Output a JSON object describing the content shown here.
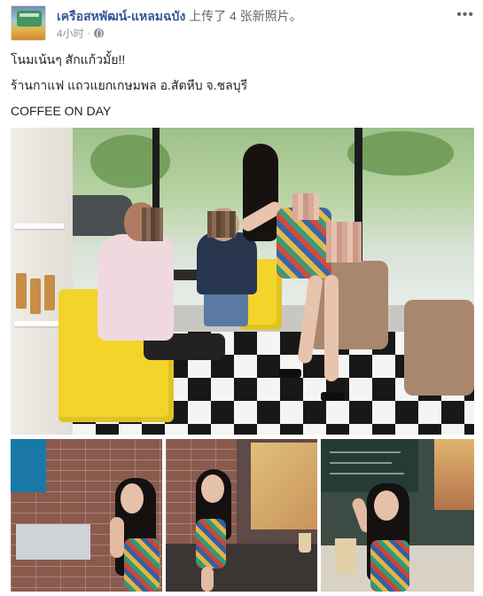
{
  "post": {
    "author_name": "เครือสหพัฒน์-แหลมฉบัง",
    "action_text": "上传了 4 张新照片。",
    "timestamp": "4小时",
    "privacy_icon": "globe-icon",
    "more_icon": "more-options-icon",
    "text_lines": [
      "โนมเน้นๆ สักแก้วมั้ย!!",
      "ร้านกาแฟ แถวแยกเกษมพล อ.สัตหีบ จ.ชลบุรี",
      "COFFEE ON DAY"
    ]
  },
  "photos": {
    "count": 4
  },
  "colors": {
    "author_link": "#365899",
    "meta_text": "#90949c",
    "body_text": "#1d2129"
  }
}
